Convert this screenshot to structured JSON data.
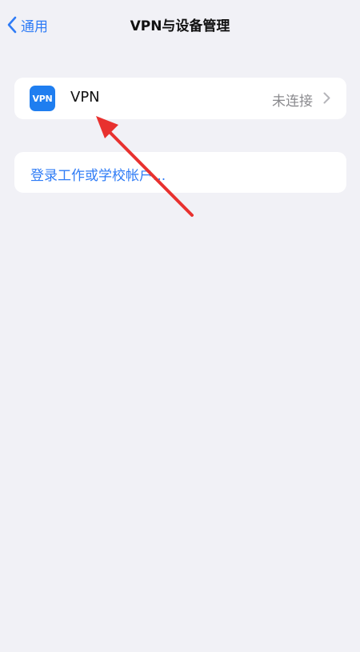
{
  "nav": {
    "back_label": "通用",
    "title": "VPN与设备管理"
  },
  "vpn": {
    "icon_text": "VPN",
    "label": "VPN",
    "status": "未连接"
  },
  "login": {
    "label": "登录工作或学校帐户..."
  },
  "colors": {
    "background": "#f1f1f6",
    "accent": "#2f7cf6",
    "vpn_icon": "#1f7ef0",
    "annotation_arrow": "#e8312f"
  }
}
